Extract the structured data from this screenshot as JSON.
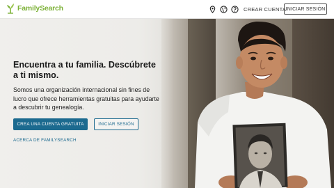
{
  "header": {
    "logo_text": "FamilySearch",
    "icons": [
      "location-pin-icon",
      "globe-icon",
      "help-icon"
    ],
    "create_account_label": "CREAR CUENTA",
    "sign_in_label": "INICIAR SESIÓN"
  },
  "hero": {
    "headline": "Encuentra a tu familia. Descúbrete a ti mismo.",
    "subtext": "Somos una organización internacional sin fines de lucro que ofrece herramientas gratuitas para ayudarte a descubrir tu genealogía.",
    "primary_button": "CREA UNA CUENTA GRATUITA",
    "secondary_button": "INICIAR SESIÓN",
    "about_link": "ACERCA DE FAMILYSEARCH"
  },
  "colors": {
    "brand_green": "#7eb23a",
    "primary_blue": "#1c6a8f",
    "text_dark": "#1a1a1a"
  }
}
